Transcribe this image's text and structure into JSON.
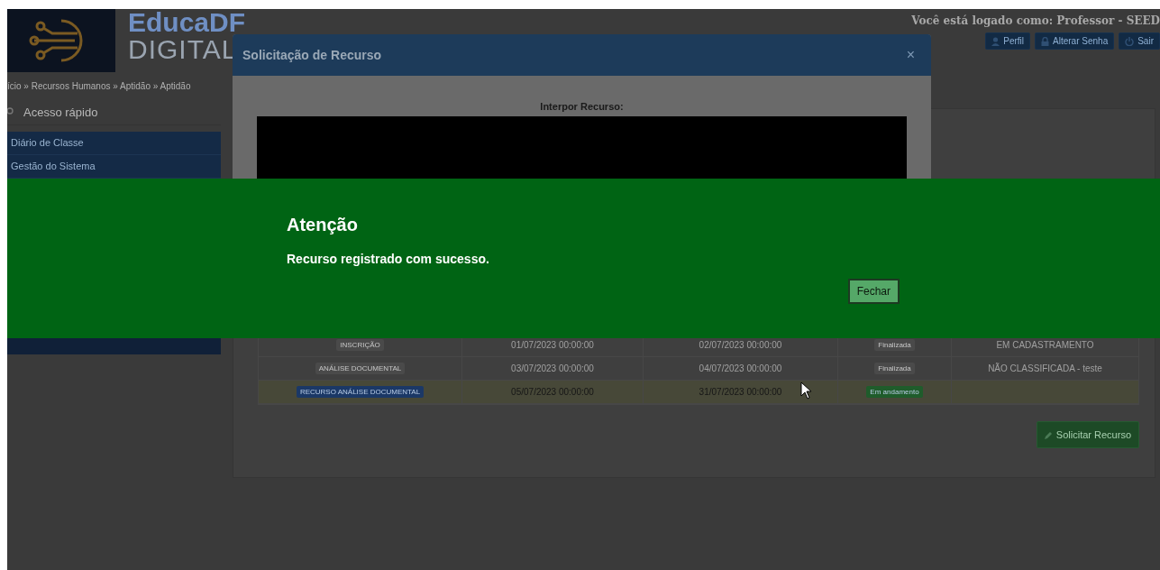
{
  "header": {
    "brand_line1": "EducaDF",
    "brand_line2": "DIGITAL",
    "user_text": "Você está logado como: Professor - SEED",
    "buttons": [
      {
        "label": "Perfil",
        "kind": "user"
      },
      {
        "label": "Alterar Senha",
        "kind": "lock"
      },
      {
        "label": "Sair",
        "kind": "power"
      }
    ]
  },
  "breadcrumb": "ício » Recursos Humanos » Aptidão » Aptidão",
  "quick_access": {
    "placeholder": "Acesso rápido"
  },
  "sidebar": {
    "items": [
      {
        "label": "Diário de Classe"
      },
      {
        "label": "Gestão do Sistema"
      }
    ]
  },
  "table": {
    "rows": [
      {
        "stage": {
          "label": "INSCRIÇÃO",
          "color": "#4a4a4a"
        },
        "start": "01/07/2023 00:00:00",
        "end": "02/07/2023 00:00:00",
        "status": {
          "label": "Finalizada",
          "color": "#4a4a4a"
        },
        "result": "EM CADASTRAMENTO",
        "selected": false
      },
      {
        "stage": {
          "label": "ANÁLISE DOCUMENTAL",
          "color": "#4a4a4a"
        },
        "start": "03/07/2023 00:00:00",
        "end": "04/07/2023 00:00:00",
        "status": {
          "label": "Finalizada",
          "color": "#4a4a4a"
        },
        "result": "NÃO CLASSIFICADA - teste",
        "selected": false
      },
      {
        "stage": {
          "label": "RECURSO ANÁLISE DOCUMENTAL",
          "color": "#1b3866"
        },
        "start": "05/07/2023 00:00:00",
        "end": "31/07/2023 00:00:00",
        "status": {
          "label": "Em andamento",
          "color": "#1f5c2b"
        },
        "result": "",
        "selected": true
      }
    ]
  },
  "action_button": "Solicitar Recurso",
  "modal": {
    "title": "Solicitação de Recurso",
    "close": "×",
    "field_label": "Interpor Recurso:"
  },
  "alert": {
    "title": "Atenção",
    "message": "Recurso registrado com sucesso.",
    "button": "Fechar"
  }
}
